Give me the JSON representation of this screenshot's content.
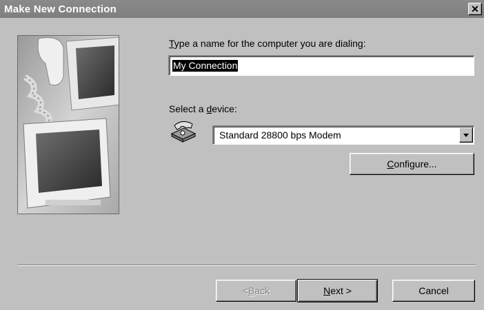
{
  "window": {
    "title": "Make New Connection",
    "close_glyph": "✕"
  },
  "name_field": {
    "label_underlined": "T",
    "label_rest": "ype a name for the computer you are dialing:",
    "value": "My Connection"
  },
  "device": {
    "label_before": "Select a ",
    "label_underlined": "d",
    "label_after": "evice:",
    "selected": "Standard 28800 bps Modem",
    "icon": "telephone-modem-icon"
  },
  "buttons": {
    "configure_underlined": "C",
    "configure_rest": "onfigure...",
    "back_before": "< ",
    "back_underlined": "B",
    "back_after": "ack",
    "next_underlined": "N",
    "next_after": "ext >",
    "cancel": "Cancel"
  },
  "colors": {
    "titlebar": "#808080",
    "dialog": "#c0c0c0"
  }
}
